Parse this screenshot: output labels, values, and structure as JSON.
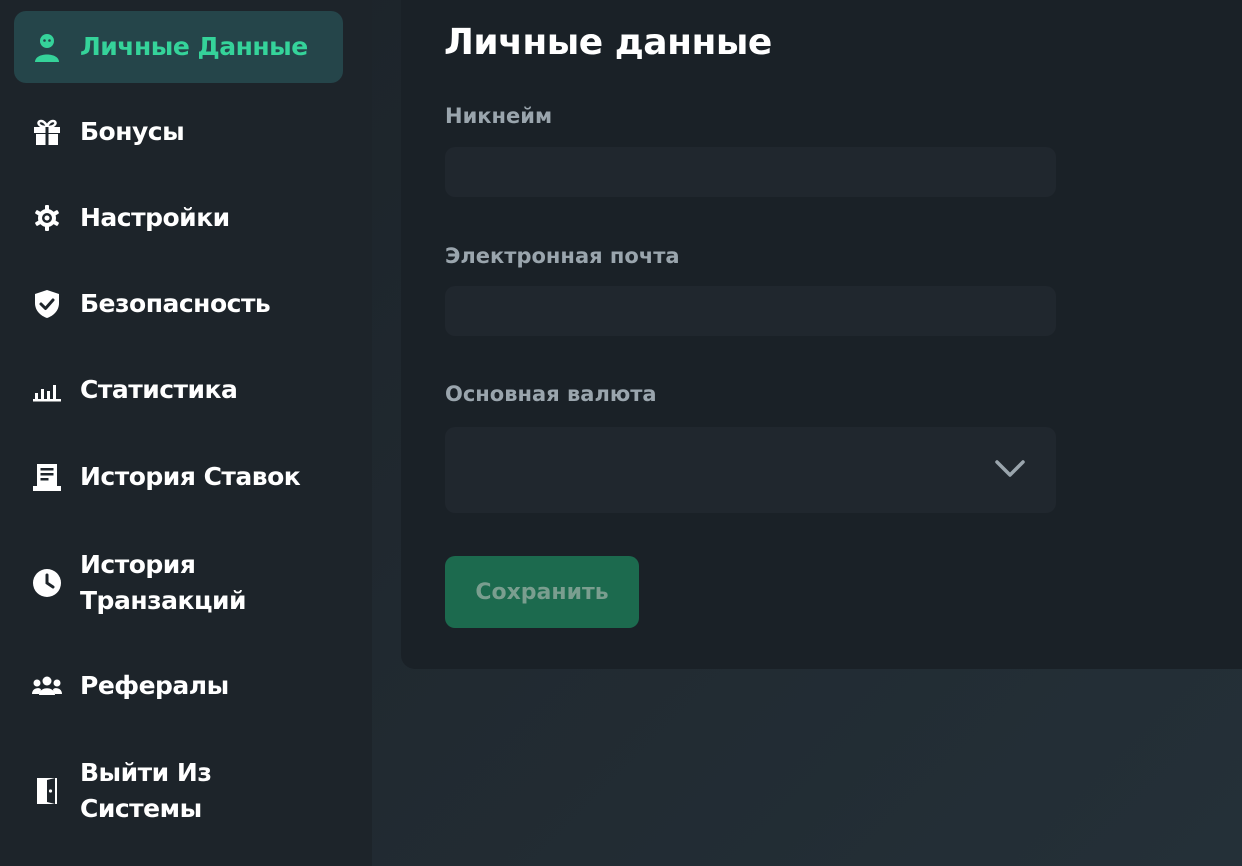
{
  "sidebar": {
    "items": [
      {
        "label": "Личные Данные",
        "icon": "user-icon",
        "active": true
      },
      {
        "label": "Бонусы",
        "icon": "gift-icon"
      },
      {
        "label": "Настройки",
        "icon": "gear-icon"
      },
      {
        "label": "Безопасность",
        "icon": "shield-check-icon"
      },
      {
        "label": "Статистика",
        "icon": "bar-chart-icon"
      },
      {
        "label": "История Ставок",
        "icon": "ticket-list-icon"
      },
      {
        "label": "История Транзакций",
        "icon": "clock-icon"
      },
      {
        "label": "Рефералы",
        "icon": "users-icon"
      },
      {
        "label": "Выйти Из Системы",
        "icon": "door-exit-icon"
      }
    ]
  },
  "main": {
    "title": "Личные данные",
    "fields": {
      "nickname": {
        "label": "Никнейм",
        "value": ""
      },
      "email": {
        "label": "Электронная почта",
        "value": ""
      },
      "currency": {
        "label": "Основная валюта",
        "value": ""
      }
    },
    "save_label": "Сохранить"
  },
  "colors": {
    "accent": "#35d39a",
    "active_bg": "#25454a",
    "button_bg": "#1c6a4e"
  }
}
